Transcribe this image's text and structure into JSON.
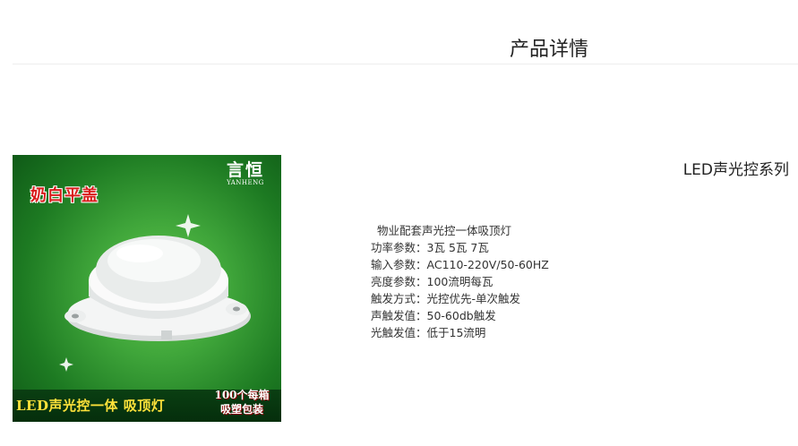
{
  "header": {
    "title": "产品详情"
  },
  "product": {
    "series_title": "LED声光控系列",
    "image": {
      "brand_cn": "言恒",
      "brand_en": "YANHENG",
      "top_tag": "奶白平盖",
      "banner_text": "LED声光控一体 吸顶灯",
      "badge_line1": "100个每箱",
      "badge_line2": "吸塑包装"
    },
    "specs": {
      "headline": "物业配套声光控一体吸顶灯",
      "rows": [
        {
          "label": "功率参数：",
          "value": "3瓦  5瓦  7瓦"
        },
        {
          "label": "输入参数：",
          "value": "AC110-220V/50-60HZ"
        },
        {
          "label": "亮度参数：",
          "value": "100流明每瓦"
        },
        {
          "label": "触发方式：",
          "value": "光控优先-单次触发"
        },
        {
          "label": "声触发值：",
          "value": "50-60db触发"
        },
        {
          "label": "光触发值：",
          "value": "低于15流明"
        }
      ]
    }
  }
}
